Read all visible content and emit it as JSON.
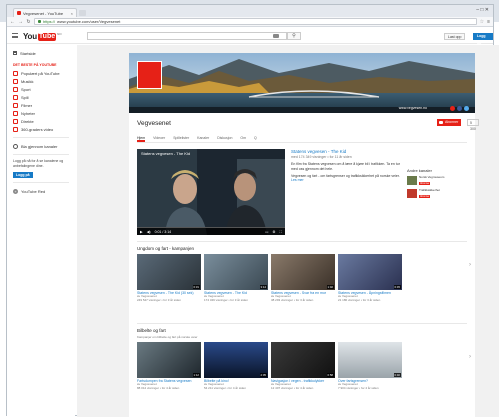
{
  "browser": {
    "tab_title": "Vegvesenet - YouTube",
    "url_scheme": "https://",
    "url_rest": "www.youtube.com/user/Vegvesenet",
    "window_controls": "– □ ✕"
  },
  "yt": {
    "logo_you": "You",
    "logo_tube": "Tube",
    "logo_cc": "NO",
    "upload": "Last opp",
    "signin": "Logg på"
  },
  "sidebar": {
    "home": "Startside",
    "section_title": "DET BESTE PÅ YOUTUBE",
    "categories": [
      "Populært på YouTube",
      "Musikk",
      "Sport",
      "Spill",
      "Filmer",
      "Nyheter",
      "Direkte",
      "360-graders video"
    ],
    "browse_channels": "Bla gjennom kanaler",
    "signin_text": "Logg på nå for å se kanalene og anbefalingene dine.",
    "signin_button": "Logg på",
    "paid": "YouTube Red"
  },
  "channel": {
    "title": "Vegvesenet",
    "subscribe": "Abonner",
    "sub_count": "5 300",
    "banner_url": "www.vegvesen.no",
    "banner_logo_text": "Statens vegvesen",
    "tabs": [
      "Hjem",
      "Videoer",
      "Spillelister",
      "Kanaler",
      "Diskusjon",
      "Om",
      "Q"
    ]
  },
  "featured": {
    "player_title": "Statens vegvesen - The Kid",
    "time": "0:01 / 3:14",
    "title": "Statens vegvesen - The Kid",
    "meta_1": "med 174 349 visninger • for 11 år siden",
    "desc": "En film fra Statens vegvesen om å lære å kjøre bil i trafikken. Ta en tur med oss gjennom det hele.",
    "meta_2": "Vegvesen og fart - om fartsgrenser og trafikksikkerhet på norske veier.",
    "more": "Les mer"
  },
  "related": {
    "heading": "Andre kanaler",
    "items": [
      {
        "name": "Norsk Vegmuseum",
        "btn": "Abonner"
      },
      {
        "name": "Trafikksikkerhet",
        "btn": "Abonner"
      }
    ]
  },
  "section1": {
    "title": "Ungdom og fart - kampanjen",
    "videos": [
      {
        "title": "Statens vegvesen - The Kid (30 sek)",
        "channel": "av Vegvesenet",
        "meta": "249 547 visninger • for 3 år siden",
        "dur": "0:31"
      },
      {
        "title": "Statens vegvesen - The Kid",
        "channel": "av Vegvesenet",
        "meta": "174 349 visninger • for 3 år siden",
        "dur": "3:14"
      },
      {
        "title": "Statens vegvesen - Svar fra en mor",
        "channel": "av Vegvesenet",
        "meta": "38 293 visninger • for 3 år siden",
        "dur": "1:02"
      },
      {
        "title": "Statens vegvesen - Åpningsfilmen",
        "channel": "av Vegvesenet",
        "meta": "21 180 visninger • for 3 år siden",
        "dur": "0:45"
      }
    ]
  },
  "section2": {
    "title": "Bilbelte og fart",
    "subtitle": "Kampanjer om bilbelte og fart på norske veier",
    "videos": [
      {
        "title": "Fartsdumpen fra Statens vegvesen",
        "channel": "av Vegvesenet",
        "meta": "88 012 visninger • for 4 år siden",
        "dur": "1:12"
      },
      {
        "title": "Bilbelte på kino!",
        "channel": "av Vegvesenet",
        "meta": "54 211 visninger • for 4 år siden",
        "dur": "2:05"
      },
      {
        "title": "Navigasjon i vegen - trafikkulykker",
        "channel": "av Vegvesenet",
        "meta": "12 407 visninger • for 4 år siden",
        "dur": "0:58"
      },
      {
        "title": "Over fartsgrensen?",
        "channel": "av Vegvesenet",
        "meta": "7 904 visninger • for 4 år siden",
        "dur": "0:40"
      }
    ]
  }
}
